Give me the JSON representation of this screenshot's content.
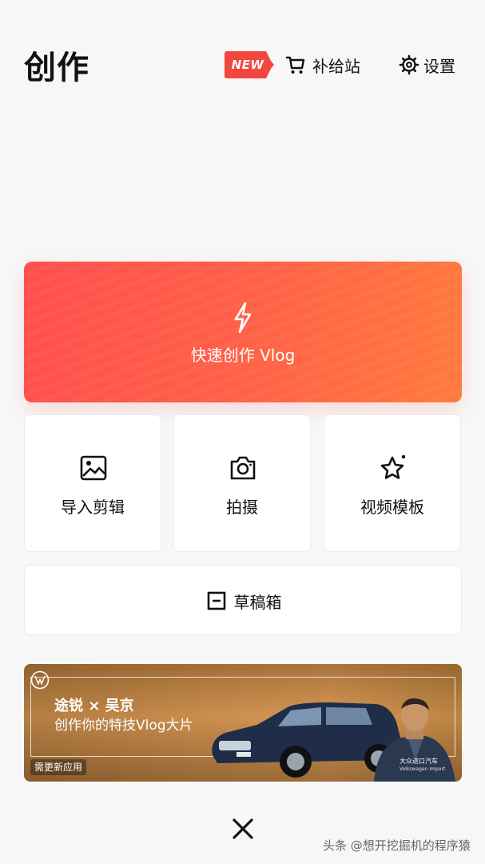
{
  "header": {
    "title": "创作",
    "new_badge": "NEW",
    "supply_label": "补给站",
    "settings_label": "设置"
  },
  "quick_create": {
    "label": "快速创作 Vlog"
  },
  "tools": {
    "import_label": "导入剪辑",
    "shoot_label": "拍摄",
    "template_label": "视频模板"
  },
  "drafts": {
    "label": "草稿箱"
  },
  "ad": {
    "headline": "途锐 × 吴京",
    "subline": "创作你的特技Vlog大片",
    "sponsor_tag": "需更新应用",
    "brand": "大众进口汽车",
    "brand_sub": "Volkswagen Import"
  },
  "watermark": "头条 @想开挖掘机的程序猿",
  "colors": {
    "accent_start": "#ff4f4d",
    "accent_end": "#ff7a3d",
    "new_badge": "#f2473f",
    "background": "#f7f7f7"
  },
  "icons": {
    "supply": "cart-icon",
    "settings": "gear-icon",
    "quick": "lightning-icon",
    "import": "image-icon",
    "shoot": "camera-icon",
    "template": "star-icon",
    "drafts": "draft-box-icon",
    "close": "close-icon"
  }
}
